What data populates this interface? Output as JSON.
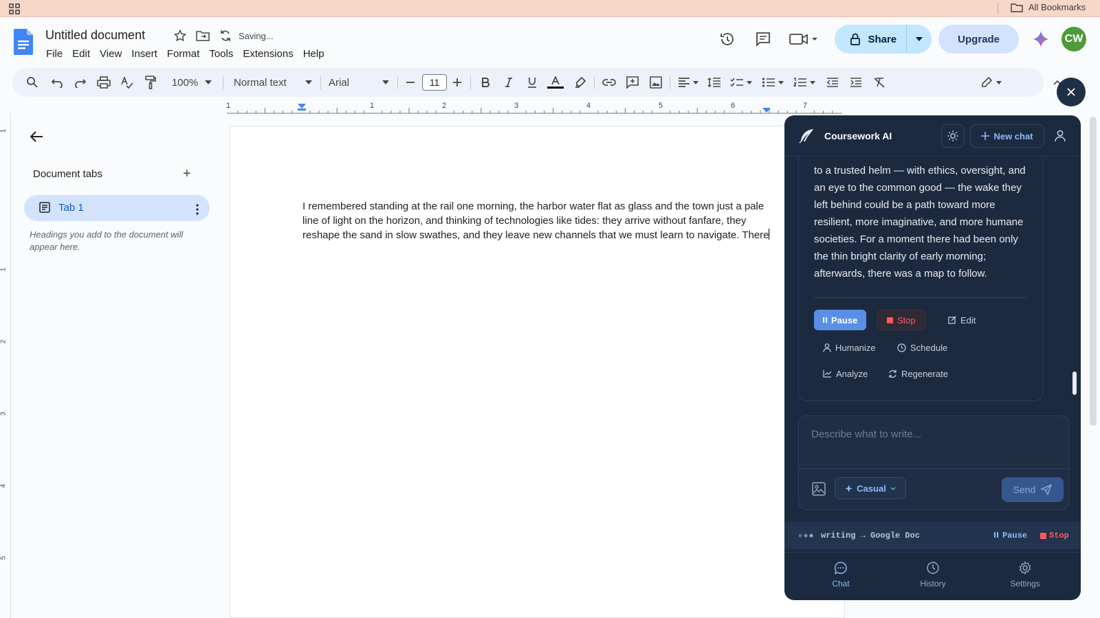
{
  "browser": {
    "bookmarks_label": "All Bookmarks"
  },
  "doc": {
    "title": "Untitled document",
    "status": "Saving...",
    "menu": [
      "File",
      "Edit",
      "View",
      "Insert",
      "Format",
      "Tools",
      "Extensions",
      "Help"
    ]
  },
  "header": {
    "share_label": "Share",
    "upgrade_label": "Upgrade",
    "avatar_initials": "CW"
  },
  "toolbar": {
    "zoom": "100%",
    "style": "Normal text",
    "font": "Arial",
    "font_size": "11"
  },
  "ruler": {
    "numbers": [
      "1",
      "1",
      "2",
      "3",
      "4",
      "5",
      "6",
      "7"
    ]
  },
  "vruler": {
    "numbers": [
      "1",
      "1",
      "2",
      "3",
      "4",
      "5"
    ]
  },
  "left_panel": {
    "title": "Document tabs",
    "tab_label": "Tab 1",
    "hint": "Headings you add to the document will appear here."
  },
  "document": {
    "body": "I remembered standing at the rail one morning, the harbor water flat as glass and the town just a pale line of light on the horizon, and thinking of technologies like tides: they arrive without fanfare, they reshape the sand in slow swathes, and they leave new channels that we must learn to navigate. There"
  },
  "ai_panel": {
    "title": "Coursework AI",
    "new_chat": "New chat",
    "message": "to a trusted helm — with ethics, oversight, and an eye to the common good — the wake they left behind could be a path toward more resilient, more imaginative, and more humane societies. For a moment there had been only the thin bright clarity of early morning; afterwards, there was a map to follow.",
    "actions": {
      "pause": "Pause",
      "stop": "Stop",
      "edit": "Edit",
      "humanize": "Humanize",
      "schedule": "Schedule",
      "analyze": "Analyze",
      "regenerate": "Regenerate"
    },
    "input_placeholder": "Describe what to write...",
    "tone": "Casual",
    "send": "Send",
    "status": {
      "text": "writing → Google Doc",
      "pause": "Pause",
      "stop": "Stop"
    },
    "nav": {
      "chat": "Chat",
      "history": "History",
      "settings": "Settings"
    },
    "colors": {
      "panel_bg": "#1c2a3f",
      "accent": "#8fb8ff",
      "stop": "#ff5b5b",
      "pause_btn": "#5b8fe6"
    }
  }
}
